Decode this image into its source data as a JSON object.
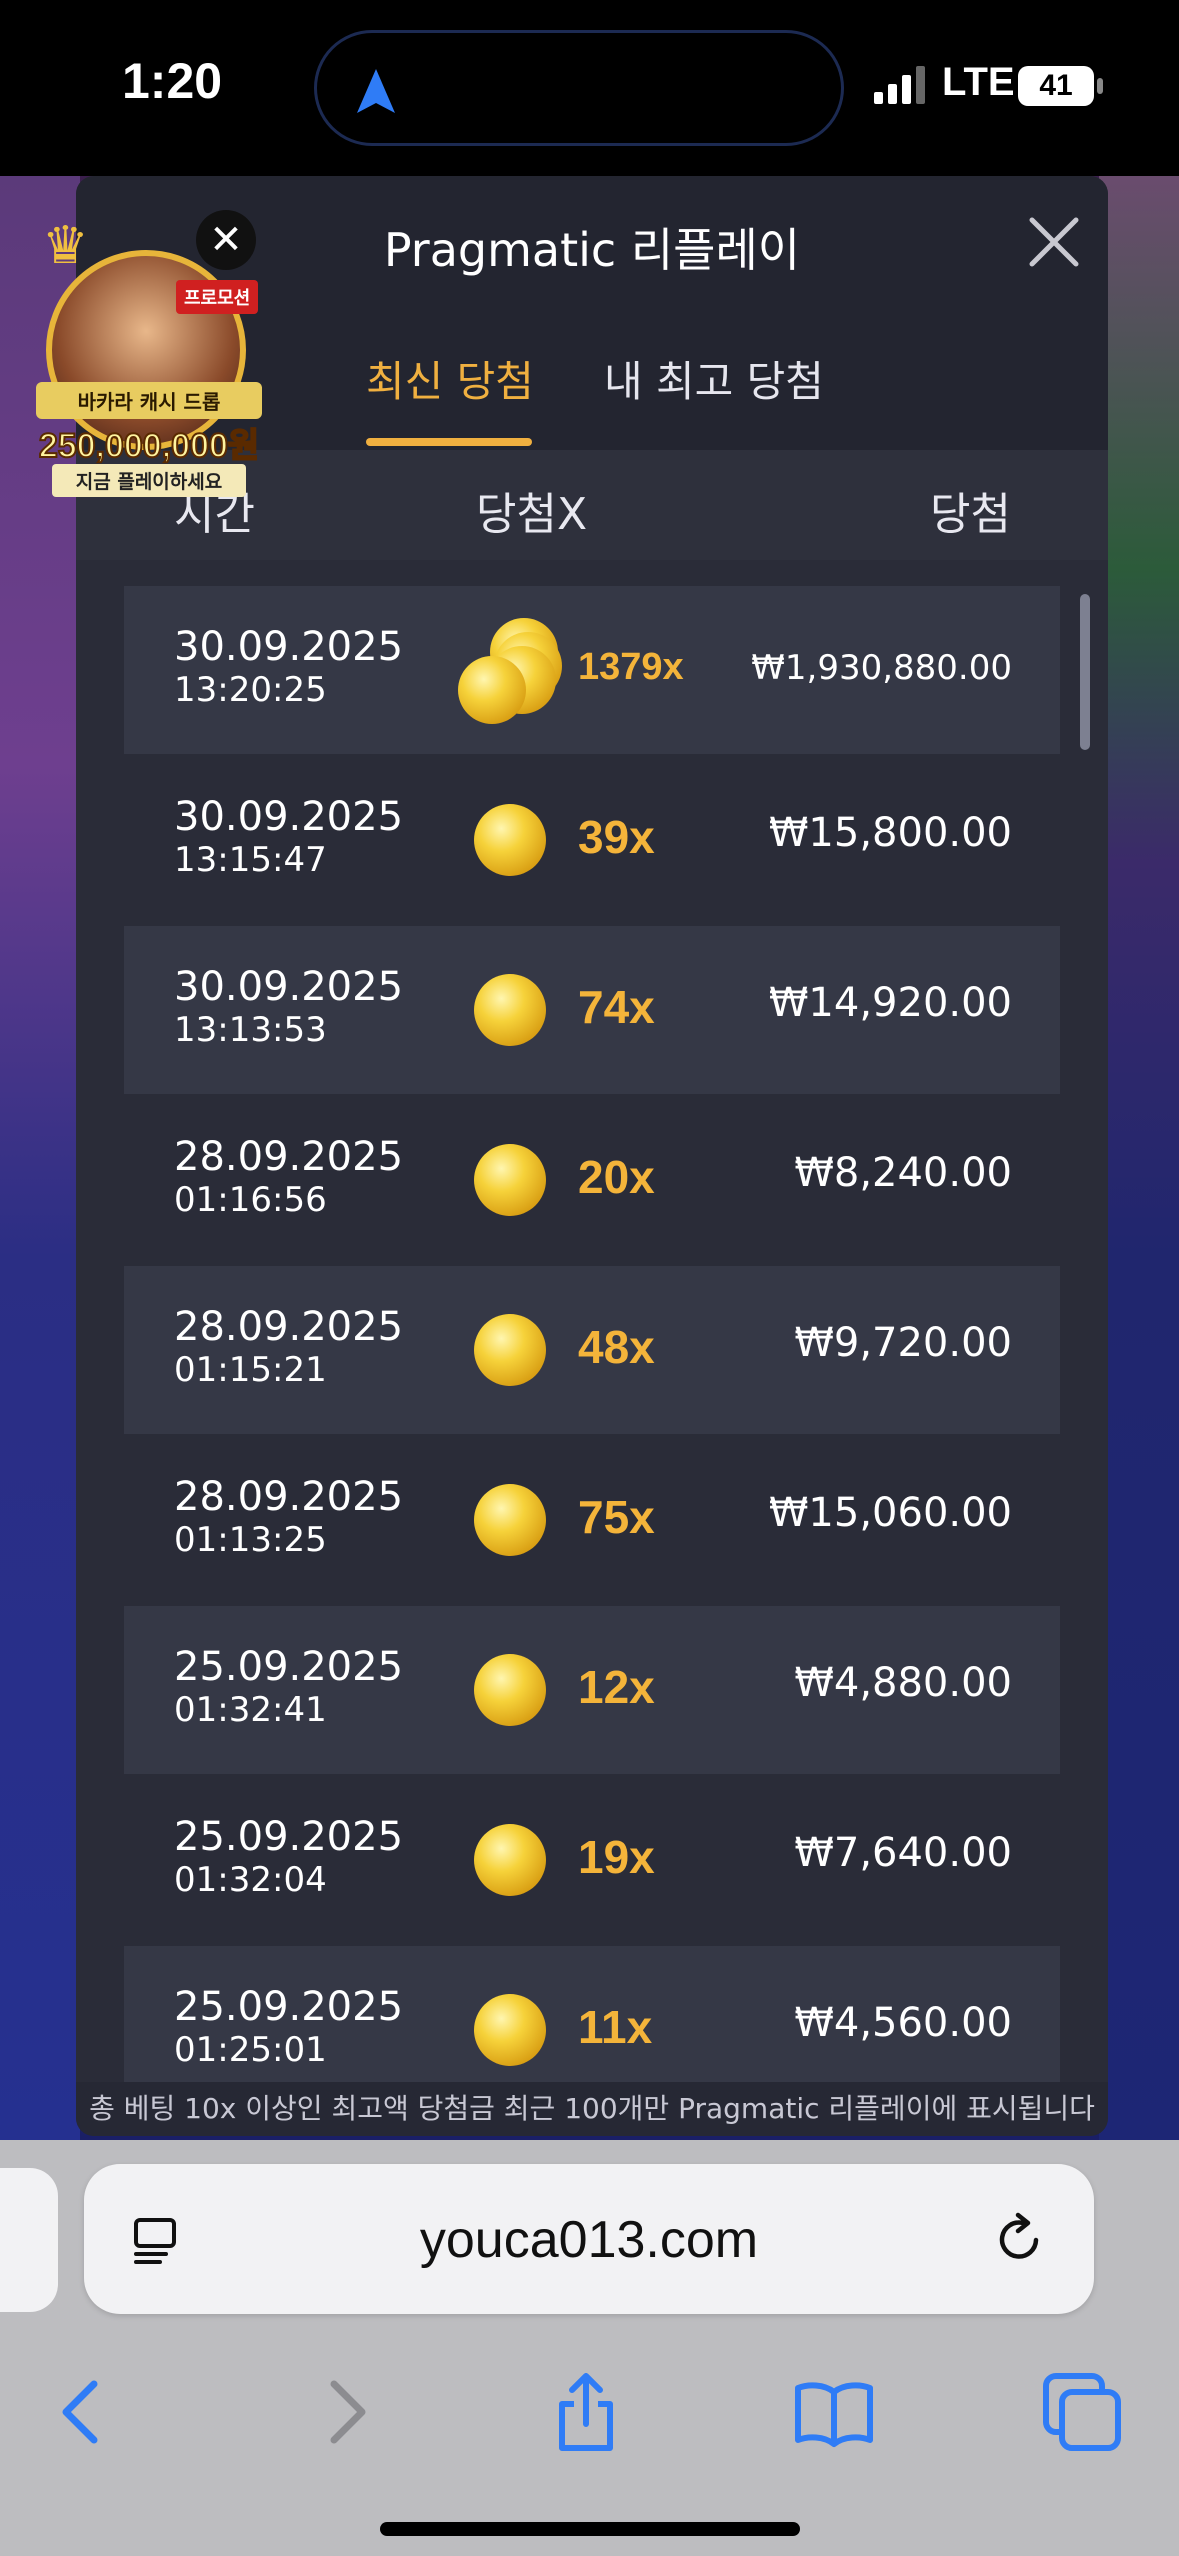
{
  "status_bar": {
    "time": "1:20",
    "network": "LTE",
    "battery": "41"
  },
  "promo": {
    "tag": "프로모션",
    "line1": "바카라 캐시 드롭",
    "amount": "250,000,000원",
    "line2": "지금 플레이하세요"
  },
  "modal": {
    "title": "Pragmatic 리플레이",
    "tabs": [
      {
        "label": "최신 당첨",
        "active": true
      },
      {
        "label": "내 최고 당첨",
        "active": false
      }
    ],
    "columns": {
      "time": "시간",
      "multiplier": "당첨X",
      "win": "당첨"
    },
    "rows": [
      {
        "date": "30.09.2025",
        "time": "13:20:25",
        "multiplier": "1379x",
        "win": "₩1,930,880.00",
        "icon": "coin-stack-icon"
      },
      {
        "date": "30.09.2025",
        "time": "13:15:47",
        "multiplier": "39x",
        "win": "₩15,800.00",
        "icon": "coin-icon"
      },
      {
        "date": "30.09.2025",
        "time": "13:13:53",
        "multiplier": "74x",
        "win": "₩14,920.00",
        "icon": "coin-icon"
      },
      {
        "date": "28.09.2025",
        "time": "01:16:56",
        "multiplier": "20x",
        "win": "₩8,240.00",
        "icon": "coin-icon"
      },
      {
        "date": "28.09.2025",
        "time": "01:15:21",
        "multiplier": "48x",
        "win": "₩9,720.00",
        "icon": "coin-icon"
      },
      {
        "date": "28.09.2025",
        "time": "01:13:25",
        "multiplier": "75x",
        "win": "₩15,060.00",
        "icon": "coin-icon"
      },
      {
        "date": "25.09.2025",
        "time": "01:32:41",
        "multiplier": "12x",
        "win": "₩4,880.00",
        "icon": "coin-icon"
      },
      {
        "date": "25.09.2025",
        "time": "01:32:04",
        "multiplier": "19x",
        "win": "₩7,640.00",
        "icon": "coin-icon"
      },
      {
        "date": "25.09.2025",
        "time": "01:25:01",
        "multiplier": "11x",
        "win": "₩4,560.00",
        "icon": "coin-icon"
      }
    ],
    "footer_note": "총 베팅 10x 이상인 최고액 당첨금 최근 100개만 Pragmatic 리플레이에 표시됩니다"
  },
  "browser": {
    "url": "youca013.com"
  },
  "colors": {
    "accent": "#f0b040",
    "modal_bg": "#2a2c38",
    "link_blue": "#2f7cf6"
  }
}
